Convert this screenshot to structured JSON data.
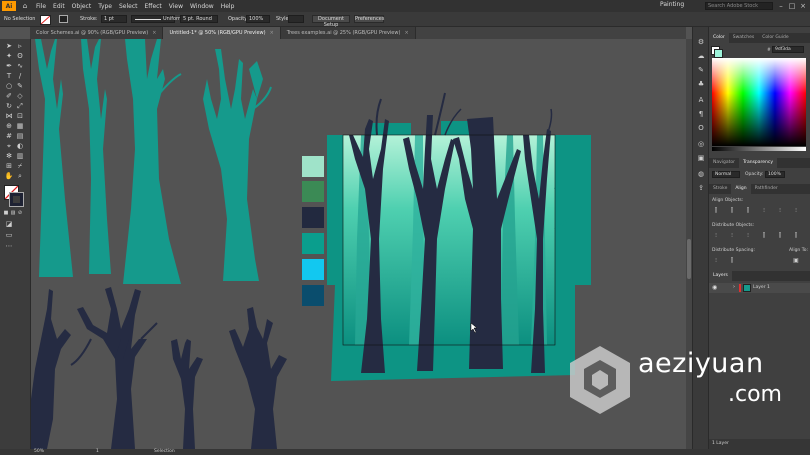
{
  "app": {
    "logo": "Ai",
    "workspace": "Painting",
    "search_placeholder": "Search Adobe Stock"
  },
  "menu": [
    "File",
    "Edit",
    "Object",
    "Type",
    "Select",
    "Effect",
    "View",
    "Window",
    "Help"
  ],
  "control_bar": {
    "selection": "No Selection",
    "stroke_label": "Stroke:",
    "stroke_value": "1 pt",
    "brush_label": "Uniform",
    "profile_value": "5 pt. Round",
    "opacity_label": "Opacity:",
    "opacity_value": "100%",
    "style_label": "Style:",
    "doc_setup": "Document Setup",
    "preferences": "Preferences"
  },
  "tabs": [
    {
      "label": "Color Schemes.ai @ 90% (RGB/GPU Preview)",
      "active": false
    },
    {
      "label": "Untitled-1* @ 50% (RGB/GPU Preview)",
      "active": true
    },
    {
      "label": "Trees examples.ai @ 25% (RGB/GPU Preview)",
      "active": false
    }
  ],
  "swatches": [
    "#9fe3c9",
    "#3b8a55",
    "#22293f",
    "#0a9e8d",
    "#12c8f0",
    "#0a4d6d"
  ],
  "colors": {
    "teal": "#159a8c",
    "dark": "#252b42"
  },
  "color_panel": {
    "tabs": [
      "Color",
      "Swatches",
      "Color Guide"
    ],
    "hex_label": "#",
    "hex_value": "9df3da"
  },
  "transparency_panel": {
    "tabs": [
      "Navigator",
      "Transparency"
    ],
    "mode": "Normal",
    "opacity_label": "Opacity:",
    "opacity_value": "100%"
  },
  "align_panel": {
    "tabs": [
      "Stroke",
      "Align",
      "Pathfinder"
    ],
    "align_objects": "Align Objects:",
    "distribute_objects": "Distribute Objects:",
    "distribute_spacing": "Distribute Spacing:",
    "align_to": "Align To:"
  },
  "layers_panel": {
    "tab": "Layers",
    "layer_name": "Layer 1",
    "count": "1 Layer"
  },
  "status_bar": {
    "zoom": "50%",
    "page": "1",
    "mode": "Selection"
  },
  "watermark": {
    "name": "aeziyuan",
    "domain": ".com"
  }
}
